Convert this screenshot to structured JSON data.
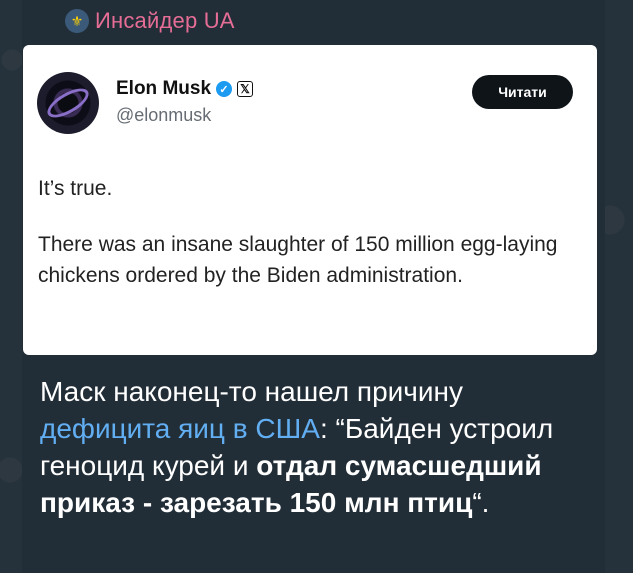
{
  "channel": {
    "flag_icon": "ukrainian-trident-icon",
    "name": "Инсайдер UA",
    "name_color": "#e56d96"
  },
  "tweet": {
    "author_name": "Elon Musk",
    "handle": "@elonmusk",
    "verified_icon": "verified-badge-icon",
    "platform_icon": "x-logo-icon",
    "read_button": "Читати",
    "line1": "It’s true.",
    "line2": "There was an insane slaughter of 150 million egg-laying chickens ordered by the Biden administration."
  },
  "caption": {
    "part1": "Маск наконец-то нашел причину ",
    "link": "дефицита яиц в США",
    "part2": ": “Байден устроил геноцид курей и ",
    "bold": "отдал сумасшедший приказ - зарезать 150 млн птиц",
    "part3": "“.",
    "link_color": "#62aef3"
  }
}
